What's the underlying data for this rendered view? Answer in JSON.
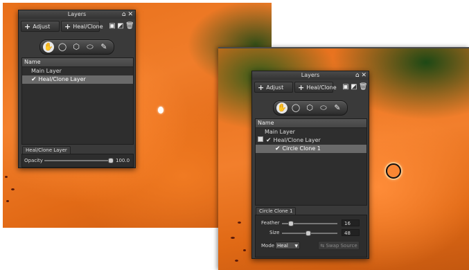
{
  "colors": {
    "panel_bg": "#3a3a3a",
    "selection": "#6a6a6a",
    "petal_orange": "#f07d2a",
    "foliage_green": "#1f5a20"
  },
  "left_panel": {
    "title": "Layers",
    "title_icons": [
      "pin-icon",
      "close-icon"
    ],
    "toolbar": {
      "adjust_label": "Adjust",
      "heal_clone_label": "Heal/Clone"
    },
    "toolbar_icons": [
      "duplicate-layer-icon",
      "mask-icon",
      "trash-icon"
    ],
    "tools": [
      "hand-tool",
      "circle-tool",
      "polygon-tool",
      "freehand-tool",
      "brush-tool"
    ],
    "active_tool": "hand-tool",
    "list": {
      "header": "Name",
      "rows": [
        {
          "label": "Main Layer",
          "checked": false,
          "selected": false
        },
        {
          "label": "Heal/Clone Layer",
          "checked": true,
          "selected": true
        }
      ]
    },
    "section": {
      "tab": "Heal/Clone Layer",
      "opacity_label": "Opacity",
      "opacity_value": "100.0",
      "opacity_fraction": 1.0
    }
  },
  "right_panel": {
    "title": "Layers",
    "title_icons": [
      "pin-icon",
      "close-icon"
    ],
    "toolbar": {
      "adjust_label": "Adjust",
      "heal_clone_label": "Heal/Clone"
    },
    "toolbar_icons": [
      "duplicate-layer-icon",
      "mask-icon",
      "trash-icon"
    ],
    "tools": [
      "hand-tool",
      "circle-tool",
      "polygon-tool",
      "freehand-tool",
      "brush-tool"
    ],
    "active_tool": "hand-tool",
    "list": {
      "header": "Name",
      "rows": [
        {
          "label": "Main Layer",
          "checked": false,
          "selected": false
        },
        {
          "label": "Heal/Clone Layer",
          "checked": true,
          "selected": false,
          "collapsible": true
        },
        {
          "label": "Circle Clone 1",
          "checked": true,
          "selected": true
        }
      ]
    },
    "section": {
      "tab": "Circle Clone 1",
      "feather_label": "Feather",
      "feather_value": "16",
      "feather_fraction": 0.16,
      "size_label": "Size",
      "size_value": "48",
      "size_fraction": 0.48,
      "mode_label": "Mode",
      "mode_value": "Heal",
      "swap_source_label": "Swap Source"
    }
  }
}
